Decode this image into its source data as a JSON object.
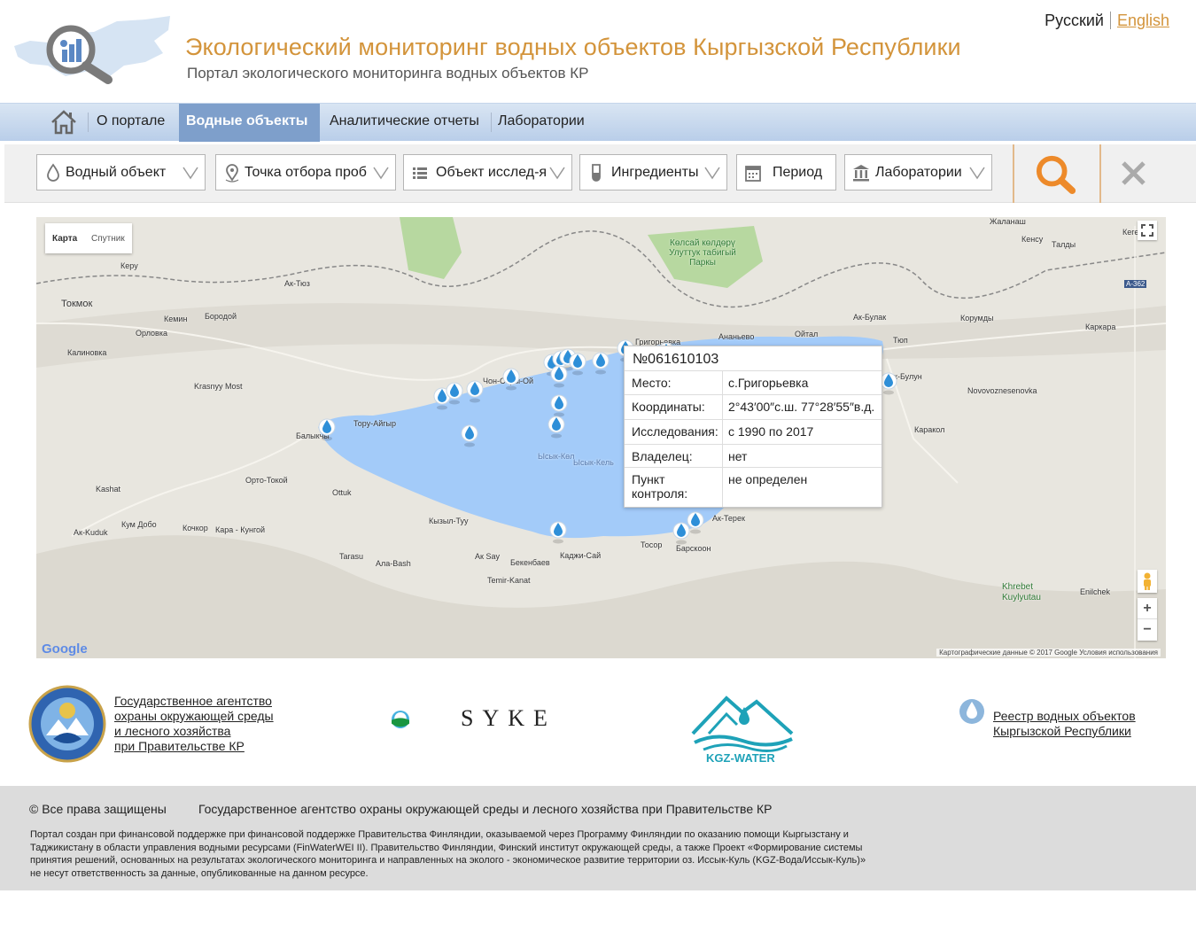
{
  "header": {
    "title": "Экологический мониторинг водных объектов Кыргызской Республики",
    "subtitle": "Портал экологического мониторинга водных объектов КР",
    "lang_ru": "Русский",
    "lang_en": "English",
    "accent_color": "#d3943b"
  },
  "nav": {
    "home_icon": "home-icon",
    "items": [
      {
        "label": "О портале"
      },
      {
        "label": "Водные объекты"
      },
      {
        "label": "Аналитические отчеты"
      },
      {
        "label": "Лаборатории"
      }
    ],
    "active_index": 1
  },
  "filters": [
    {
      "label": "Водный объект",
      "icon": "water-drop-icon"
    },
    {
      "label": "Точка отбора проб",
      "icon": "map-pin-icon"
    },
    {
      "label": "Объект исслед-я",
      "icon": "list-icon"
    },
    {
      "label": "Ингредиенты",
      "icon": "test-tube-icon"
    },
    {
      "label": "Период",
      "icon": "calendar-icon"
    },
    {
      "label": "Лаборатории",
      "icon": "institution-icon"
    }
  ],
  "map": {
    "type_map": "Карта",
    "type_satellite": "Спутник",
    "zoom_in": "+",
    "zoom_out": "−",
    "google": "Google",
    "copyright": "Картографические данные © 2017 Google   Условия использования",
    "labels": [
      "Жаланаш",
      "Кенсу",
      "Талды",
      "Кеге",
      "А-362",
      "Кеpу",
      "Ак-Тюз",
      "Токмок",
      "Кемин",
      "Бородой",
      "Орловка",
      "Калиновка",
      "Krasnyy Most",
      "Ак-Булак",
      "Корумды",
      "Каркара",
      "Ананьево",
      "Ойтал",
      "Тюп",
      "Григорьевка",
      "Чон-Сары-Ой",
      "Тору-Айгыр",
      "Балыкчы",
      "Novovoznesenovka",
      "Ак-Булун",
      "Каракол",
      "Ысык-Көл",
      "Ысык-Кель",
      "Орто-Токой",
      "Ottuk",
      "Kashat",
      "Кум Добо",
      "Кочкор",
      "Кара - Кунгой",
      "Ак-Kuduk",
      "Кызыл-Туу",
      "Ак-Терек",
      "Tarasu",
      "Ала-Bash",
      "Ак Say",
      "Бекенбаев",
      "Каджи-Сай",
      "Тосор",
      "Барскоон",
      "Temir-Kanat",
      "Khrebet Kuylyutau",
      "Enilchek",
      "Көлсай көлдөрү Улуттук табигый Паркы"
    ]
  },
  "popup": {
    "id": "№061610103",
    "rows": [
      {
        "key": "Место:",
        "value": "с.Григорьевка"
      },
      {
        "key": "Координаты:",
        "value": "2°43′00″с.ш. 77°28′55″в.д."
      },
      {
        "key": "Исследования:",
        "value": "с 1990 по 2017"
      },
      {
        "key": "Владелец:",
        "value": "нет"
      },
      {
        "key": "Пункт контроля:",
        "value": "не определен"
      }
    ]
  },
  "partners": {
    "agency_lines": [
      "Государственное агентство",
      "охраны окружающей среды",
      "и лесного хозяйства",
      "при Правительстве КР"
    ],
    "syke": "SYKE",
    "kgz_water": "KGZ-WATER",
    "registry_lines": [
      "Реестр водных объектов",
      "Кыргызской Республики"
    ]
  },
  "footer": {
    "copyright": "© Все права защищены",
    "agency": "Государственное агентство охраны окружающей среды и лесного хозяйства при Правительстве КР",
    "note_lines": [
      "Портал создан при финансовой поддержке при финансовой поддержке Правительства Финляндии, оказываемой через Программу Финляндии по оказанию помощи Кыргызстану и",
      "Таджикистану в области управления водными ресурсами (FinWaterWEI II). Правительство Финляндии, Финский институт окружающей среды, а также Проект «Формирование системы",
      "принятия решений, основанных на результатах экологического мониторинга и направленных на эколого - экономическое развитие территории оз. Иссык-Куль (KGZ-Вода/Иссык-Куль)»",
      "не несут ответственность за данные, опубликованные на данном ресурсе."
    ]
  }
}
